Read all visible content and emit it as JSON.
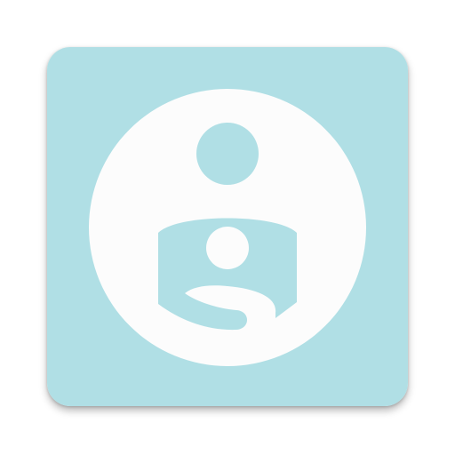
{
  "app_icon": {
    "icon_name": "nursing-mother-icon",
    "colors": {
      "tile": "#b0dfe5",
      "disc": "#fcfcfc",
      "glyph": "#b0dfe5"
    }
  }
}
